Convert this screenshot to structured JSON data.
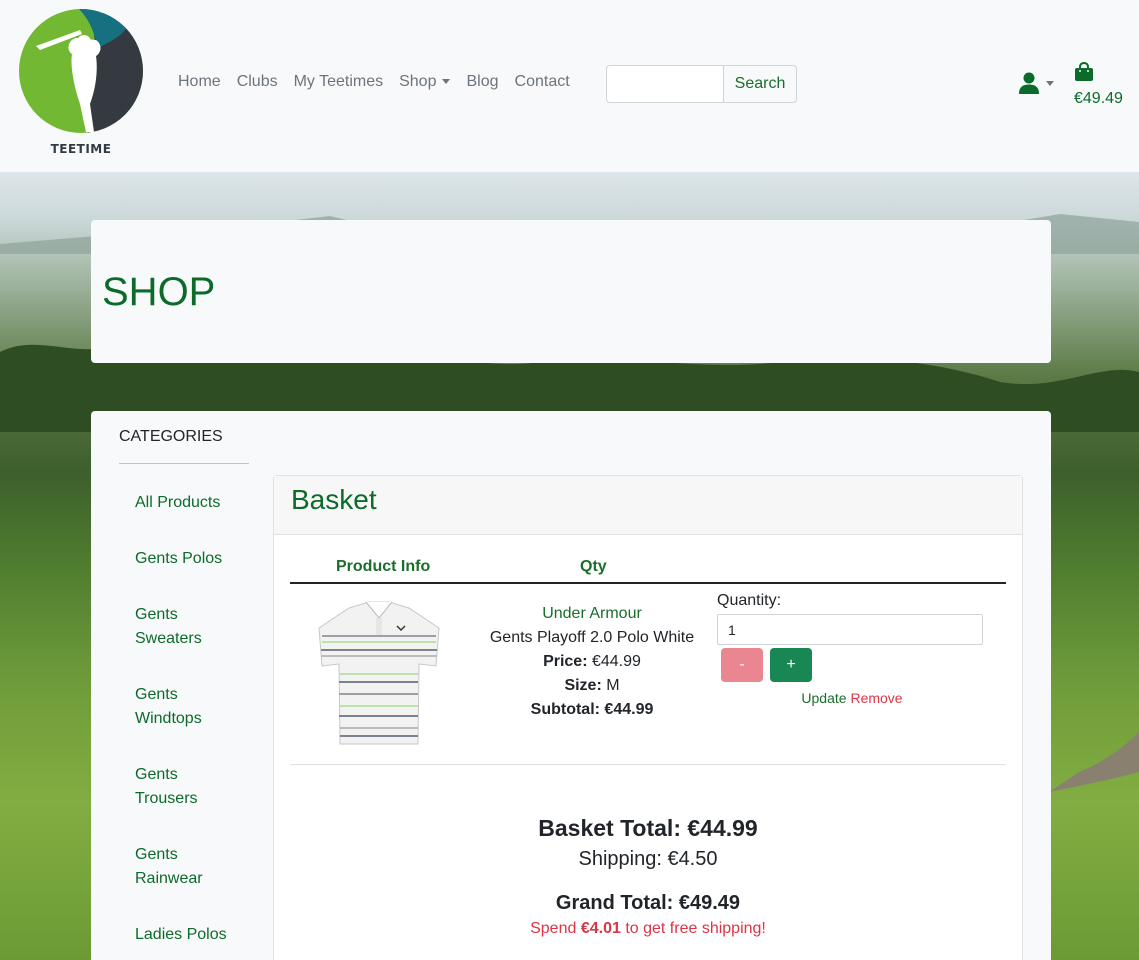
{
  "brand": {
    "logo_text": "TEETIME"
  },
  "nav": {
    "links": [
      "Home",
      "Clubs",
      "My Teetimes",
      "Shop",
      "Blog",
      "Contact"
    ],
    "search_button": "Search",
    "search_placeholder": "",
    "basket_amount": "€49.49"
  },
  "page": {
    "title": "SHOP"
  },
  "categories": {
    "title": "CATEGORIES",
    "items": [
      [
        "All Products"
      ],
      [
        "Gents Polos"
      ],
      [
        "Gents",
        "Sweaters"
      ],
      [
        "Gents",
        "Windtops"
      ],
      [
        "Gents",
        "Trousers"
      ],
      [
        "Gents",
        "Rainwear"
      ],
      [
        "Ladies Polos"
      ]
    ]
  },
  "basket": {
    "title": "Basket",
    "headers": {
      "product_info": "Product Info",
      "qty": "Qty"
    },
    "item": {
      "brand": "Under Armour",
      "name": "Gents Playoff 2.0 Polo White",
      "price_label": "Price:",
      "price": "€44.99",
      "size_label": "Size:",
      "size": "M",
      "subtotal_label": "Subtotal:",
      "subtotal": "€44.99"
    },
    "quantity_label": "Quantity:",
    "quantity_value": "1",
    "minus_label": "-",
    "plus_label": "+",
    "update_label": "Update",
    "remove_label": "Remove",
    "basket_total": "Basket Total: €44.99",
    "shipping": "Shipping: €4.50",
    "grand_total": "Grand Total: €49.49",
    "spend_prefix": "Spend",
    "spend_amount": "€4.01",
    "spend_suffix": "to get free shipping!"
  },
  "colors": {
    "brand_green": "#0c6b2b",
    "danger": "#dc3545",
    "success": "#198754"
  }
}
